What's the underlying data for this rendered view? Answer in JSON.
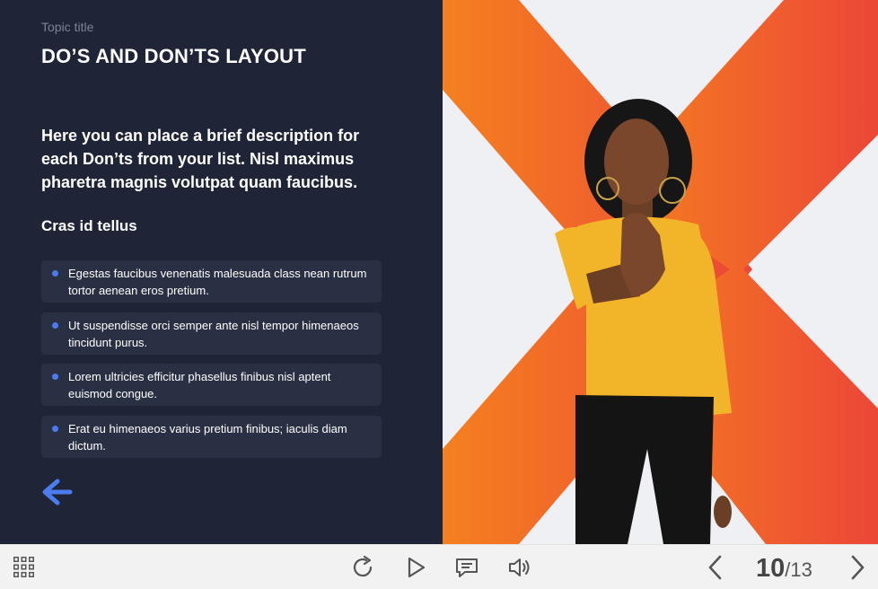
{
  "slide": {
    "topic_title": "Topic title",
    "title": "DO’S AND DON’TS LAYOUT",
    "description": "Here you can place a brief description for each Don’ts from your list. Nisl maximus pharetra magnis volutpat quam faucibus.",
    "subheading": "Cras id tellus",
    "items": [
      {
        "text": "Egestas faucibus venenatis malesuada class nean rutrum tortor aenean eros pretium."
      },
      {
        "text": "Ut suspendisse orci semper ante nisl tempor himenaeos tincidunt purus."
      },
      {
        "text": "Lorem ultricies efficitur phasellus finibus nisl aptent euismod congue."
      },
      {
        "text": "Erat eu himenaeos varius pretium finibus; iaculis diam dictum."
      }
    ],
    "back_icon": "arrow-left-icon"
  },
  "colors": {
    "panel_bg": "#1f2436",
    "card_bg": "#2a3043",
    "accent": "#4c7bef",
    "x_orange": "#f5801f",
    "x_red": "#ec4637"
  },
  "toolbar": {
    "icons": [
      "grid-icon",
      "replay-icon",
      "play-icon",
      "comment-icon",
      "volume-icon",
      "chevron-left-icon",
      "chevron-right-icon"
    ],
    "page_current": "10",
    "page_separator": "/",
    "page_total": "13"
  }
}
